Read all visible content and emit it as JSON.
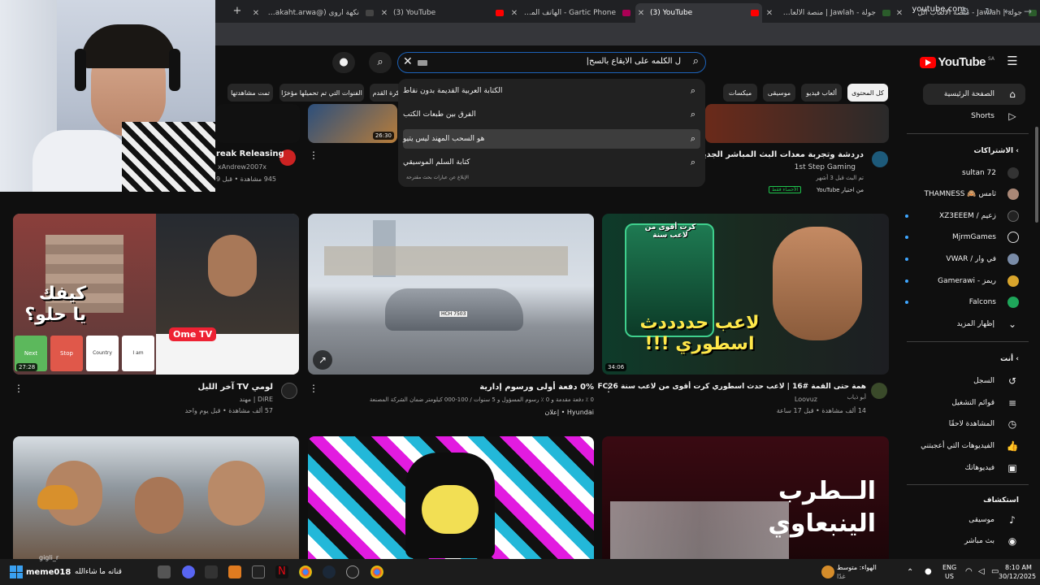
{
  "browser": {
    "tabs": [
      {
        "title": "جولة | Jawlah - منصة الألعاب الل",
        "fav": "#2b5c2b"
      },
      {
        "title": "جولة - Jawlah | منصة الألعاب ال",
        "fav": "#2b5c2b"
      },
      {
        "title": "(3) YouTube",
        "fav": "#ff0000"
      },
      {
        "title": "Gartic Phone - الهاتف المكسور",
        "fav": "#a05"
      },
      {
        "title": "(3) YouTube",
        "fav": "#ff0000"
      },
      {
        "title": "نكهة أروى (@nakaht.arwa) | TikTok",
        "fav": "#111"
      }
    ],
    "new_tab": "+",
    "url": "youtube.com"
  },
  "header": {
    "logo": "YouTube",
    "region": "SA",
    "search_query": "ل الكلمه على الايقاع بالسح|",
    "clear": "✕",
    "search_icon": "⌕",
    "mic_icon": "🎙"
  },
  "chips": [
    "كل المحتوى",
    "ألعاب فيديو",
    "موسيقى",
    "ميكسات",
    "بو",
    "كرة القدم",
    "الفنوات التي تم تحميلها مؤخرًا",
    "تمت مشاهدتها"
  ],
  "suggestions": [
    "الكتابة العربية القديمة بدون نقاط",
    "الفرق بين طبعات الكتب",
    "هو السحب المهند ليس يتيو",
    "كتابة السلم الموسيقي"
  ],
  "report_text": "الإبلاغ عن عبارات بحث مقترحة",
  "sidebar": {
    "home": "الصفحة الرئيسية",
    "shorts": "Shorts",
    "subs_heading": "الاشتراكات",
    "subscriptions": [
      {
        "name": "sultan 72",
        "dot": false
      },
      {
        "name": "THAMNESS 🙈 ثامس",
        "dot": false
      },
      {
        "name": "XZ3EEEM / زعيم",
        "dot": true
      },
      {
        "name": "MjrmGames",
        "dot": true
      },
      {
        "name": "VWAR / في وار",
        "dot": true
      },
      {
        "name": "Gamerawi - ريمز",
        "dot": true
      },
      {
        "name": "Falcons",
        "dot": true
      }
    ],
    "show_more": "إظهار المزيد",
    "you_heading": "أنت",
    "you_items": [
      "السجل",
      "قوائم التشغيل",
      "المشاهدة لاحقًا",
      "الفيديوهات التي أعجبتني",
      "فيديوهاتك"
    ],
    "explore_heading": "استكشاف",
    "explore_items": [
      "موسيقى",
      "بث مباشر"
    ]
  },
  "top_row": {
    "v1": {
      "title": "reak Releasing",
      "channel": "xAndrew2007x",
      "meta": "945 مشاهدة • قبل 9"
    },
    "v2": {
      "duration": "26:30"
    },
    "v3": {
      "title": "دردشة وتجربة معدات البث المباشر الجديدة",
      "channel": "1st Step Gaming",
      "meta": "تم البث قبل 3 أشهر",
      "pick": "من اختيار YouTube",
      "badge": "الأحصاء فقط"
    }
  },
  "videos": [
    {
      "title": "لومي TV آخر الليل",
      "channel": "DiRE | مهند",
      "meta": "57 ألف مشاهدة • قبل يوم واحد",
      "duration": "27:28",
      "overlay": "كيفك يا حلو؟",
      "ome": "Ome TV",
      "btns": [
        "Next",
        "Stop",
        "Country",
        "I am"
      ]
    },
    {
      "title": "0% دفعة أولى ورسوم إدارية",
      "channel": "",
      "meta": "0 ٪ دفعة مقدمة و 0 ٪ رسوم المسؤول و 5 سنوات / 100-000 كيلومتر ضمان الشركة المصنعة",
      "sponsor": "Hyundai • إعلان",
      "plate": "HCH 7503"
    },
    {
      "title": "همة حتى القمة #16 | لاعب حدث اسطوري كرت أقوى من لاعب سنة FC26",
      "channel": "Loovuz",
      "meta": "14 ألف مشاهدة • قبل 17 ساعة",
      "duration": "34:06",
      "overlay": "لاعب حددددث اسطوري !!!",
      "card": "كرت أقوى من لاعب سنة",
      "sub": "أبو ذياب"
    }
  ],
  "bottom_row": [
    {
      "title": ""
    },
    {
      "title": ""
    },
    {
      "overlay": "الــطرب الينبعاوي"
    }
  ],
  "taskbar": {
    "weather_title": "الهواء: متوسط",
    "weather_sub": "غدًا",
    "lang": "ENG",
    "region": "US",
    "time": "8:10 AM",
    "date": "30/12/2025",
    "stream_user": "meme018",
    "stream_msg": "قناته ما شاءالله",
    "stream_alt": "gigli_r"
  }
}
